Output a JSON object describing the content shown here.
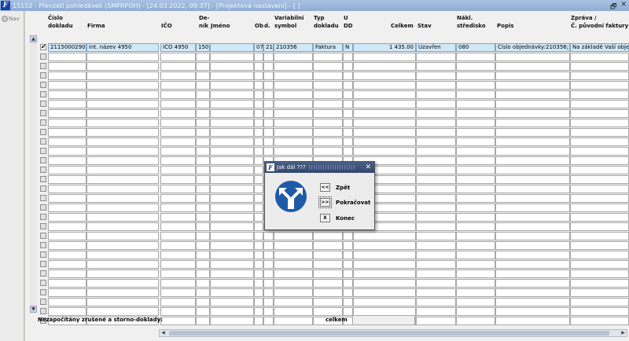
{
  "window": {
    "app_icon": "app-logo-icon",
    "title": "15152 - Převzetí pohledávek (SMPRPOH) - [24.03.2022, 09:37] - [Projektové nastavení] - [ ]",
    "buttons": [
      "restore-icon",
      "close-icon"
    ]
  },
  "nav": {
    "label": "Nav"
  },
  "table": {
    "headers": [
      {
        "key": "cislo",
        "label": "Číslo\ndokladu"
      },
      {
        "key": "firma",
        "label": "Firma"
      },
      {
        "key": "ico",
        "label": "IČO"
      },
      {
        "key": "denik",
        "label": "De-\nník"
      },
      {
        "key": "jmeno",
        "label": "Jméno"
      },
      {
        "key": "ob",
        "label": "Ob"
      },
      {
        "key": "d",
        "label": "d."
      },
      {
        "key": "vs",
        "label": "Variabilní\nsymbol"
      },
      {
        "key": "typ",
        "label": "Typ\ndokladu"
      },
      {
        "key": "udd",
        "label": "U\nDD"
      },
      {
        "key": "celkem",
        "label": "Celkem"
      },
      {
        "key": "stav",
        "label": "Stav"
      },
      {
        "key": "strediska",
        "label": "Nákl.\nstředisko"
      },
      {
        "key": "popis",
        "label": "Popis"
      },
      {
        "key": "zprava",
        "label": "Zpráva /\nČ. původní faktury"
      }
    ],
    "rows": [
      {
        "checked": true,
        "cislo": "2115000290",
        "firma": "int. název 4950",
        "ico": "IČO 4950",
        "denik": "150",
        "jmeno": "",
        "ob": "07",
        "d": "21",
        "vs": "210356",
        "typ": "Faktura",
        "udd": "N",
        "celkem": "1 435.00",
        "stav": "Uzavřen",
        "strediska": "080",
        "popis": "Číslo objednávky:210356; D",
        "zprava": "Na základě Vaší obje"
      }
    ],
    "empty_rows": 29
  },
  "footer": {
    "note": "Nezapočítány zrušené a storno-doklady:",
    "total_label": "celkem",
    "total_value": ""
  },
  "dialog": {
    "title": "Jak dál ???",
    "icon": "fork-arrows-icon",
    "buttons": [
      {
        "key": "<<",
        "label": "Zpět"
      },
      {
        "key": ">>",
        "label": "Pokračovat"
      },
      {
        "key": "X",
        "label": "Konec"
      }
    ]
  },
  "colors": {
    "titlebar": "#a9c2e3",
    "selected_row": "#d1e8f7",
    "dialog_title": "#33466d",
    "dialog_icon": "#1f5aa8"
  }
}
